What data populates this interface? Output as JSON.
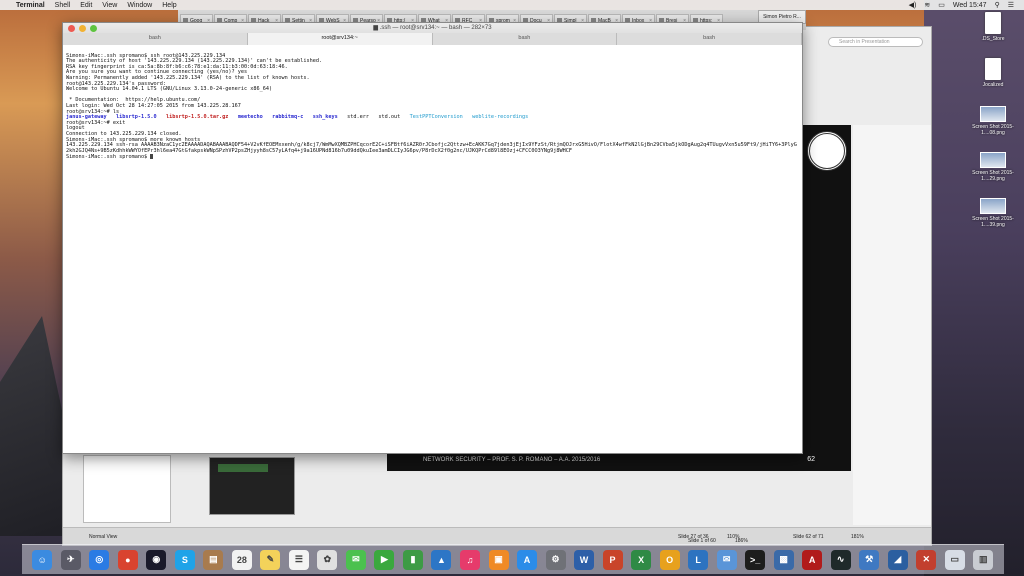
{
  "menubar": {
    "app_name": "Terminal",
    "items": [
      "Shell",
      "Edit",
      "View",
      "Window",
      "Help"
    ],
    "clock": "Wed 15:47"
  },
  "browser": {
    "tabs": [
      "Goog",
      "Comp",
      "Hack",
      "Settin",
      "WebS",
      "Pearso",
      "http:/",
      "What",
      "RFC",
      "sprom",
      "Docu",
      "Simpl",
      "MacB",
      "Inbox",
      "Bresi",
      "https:"
    ],
    "user": "Simon Pietro R..."
  },
  "presentation": {
    "search_placeholder": "Search in Presentation",
    "slide_footer": "NETWORK SECURITY – PROF. S. P. ROMANO – A.A. 2015/2016",
    "slide_number": "62",
    "status_slide": "Slide 62 of 71",
    "status_slide_left": "Slide 27 of 36",
    "status_slide_mid": "Slide 1 of 60",
    "zoom_left": "110%",
    "zoom_mid": "186%",
    "zoom_right": "181%",
    "view_label": "Normal View"
  },
  "terminal": {
    "title": "root@srv134:~ — bash — 282×73",
    "title_prefix": ".ssh",
    "tabs": [
      "bash",
      "root@srv134:~",
      "bash",
      "bash"
    ],
    "lines": [
      "Simons-iMac:.ssh spromano$ ssh root@143.225.229.134",
      "The authenticity of host '143.225.229.134 (143.225.229.134)' can't be established.",
      "RSA key fingerprint is ca:5a:8b:8f:b6:c6:78:e1:da:11:b3:00:0d:63:18:46.",
      "Are you sure you want to continue connecting (yes/no)? yes",
      "Warning: Permanently added '143.225.229.134' (RSA) to the list of known hosts.",
      "root@143.225.229.134's password:",
      "Welcome to Ubuntu 14.04.1 LTS (GNU/Linux 3.13.0-24-generic x86_64)",
      "",
      " * Documentation:  https://help.ubuntu.com/",
      "Last login: Wed Oct 28 14:27:05 2015 from 143.225.28.167",
      "root@srv134:~# ls"
    ],
    "ls_items": [
      {
        "name": "janus-gateway",
        "kind": "dir"
      },
      {
        "name": "libsrtp-1.5.0",
        "kind": "dir"
      },
      {
        "name": "libsrtp-1.5.0.tar.gz",
        "kind": "arch"
      },
      {
        "name": "meetecho",
        "kind": "dir"
      },
      {
        "name": "rabbitmq-c",
        "kind": "dir"
      },
      {
        "name": "ssh_keys",
        "kind": "dir"
      },
      {
        "name": "std.err",
        "kind": "plain"
      },
      {
        "name": "std.out",
        "kind": "plain"
      },
      {
        "name": "TestPPTConversion",
        "kind": "hl"
      },
      {
        "name": "weblite-recordings",
        "kind": "hl"
      }
    ],
    "lines_after": [
      "root@srv134:~# exit",
      "logout",
      "Connection to 143.225.229.134 closed.",
      "Simons-iMac:.ssh spromano$ more known_hosts"
    ],
    "known_host_key": "143.225.229.134 ssh-rsa AAAAB3NzaC1yc2EAAAADAQABAAABAQDF54+V2vKfEOEMxxenh/g/k8cj7/WmMwXQMBZPHCqcorE2C+iSFBtf6iAZR0rJCbofjc2Qttzw+EcAKK7Gq7jden3jEjIx9YFzSt/RtjmQOJrxG5HivO/FlotX4wfFkN2lGjBn29CVba5jkODgAug2q4TUugvVxn5u59Ft9/jHiTY6+3PlyG2kh2GJQ4Ns+9B5zKdhhkWWYOfEPr3hl6ea47GtGfakpskWNpSPzhVP2psZHjyyh8sC57yLAfq4+j9a16UPNd816b7u09ddQkuIee3amDLCIyJG6pv/P8rDcX2f0g2nc/UJKQPrCd89l8EOzj+CFCC0O3YNg9j8WHCF",
    "prompt_last": "Simons-iMac:.ssh spromano$ "
  },
  "desktop": {
    "icons": [
      {
        "label": ".DS_Store",
        "kind": "file"
      },
      {
        "label": "Jocalized",
        "kind": "file"
      },
      {
        "label": "Screen Shot 2015-1....08.png",
        "kind": "shot"
      },
      {
        "label": "Screen Shot 2015-1....29.png",
        "kind": "shot"
      },
      {
        "label": "Screen Shot 2015-1....39.png",
        "kind": "shot"
      }
    ]
  },
  "dock": {
    "icons": [
      {
        "name": "finder-icon",
        "color": "#3b8be0",
        "glyph": "☺"
      },
      {
        "name": "launchpad-icon",
        "color": "#5a5a66",
        "glyph": "✈"
      },
      {
        "name": "safari-icon",
        "color": "#2a7be4",
        "glyph": "◎"
      },
      {
        "name": "chrome-icon",
        "color": "#d9432f",
        "glyph": "●"
      },
      {
        "name": "vinyl-icon",
        "color": "#1a1a2a",
        "glyph": "◉"
      },
      {
        "name": "skype-icon",
        "color": "#1fa3e8",
        "glyph": "S"
      },
      {
        "name": "contacts-icon",
        "color": "#a87b4e",
        "glyph": "▤"
      },
      {
        "name": "calendar-icon",
        "color": "#f2f2f2",
        "glyph": "28"
      },
      {
        "name": "notes-icon",
        "color": "#f3d25a",
        "glyph": "✎"
      },
      {
        "name": "reminders-icon",
        "color": "#f4f4f4",
        "glyph": "☰"
      },
      {
        "name": "photos-icon",
        "color": "#e0e0e0",
        "glyph": "✿"
      },
      {
        "name": "messages-icon",
        "color": "#4bc14e",
        "glyph": "✉"
      },
      {
        "name": "facetime-icon",
        "color": "#3aa83e",
        "glyph": "▶"
      },
      {
        "name": "numbers-icon",
        "color": "#3d9b45",
        "glyph": "▮"
      },
      {
        "name": "keynote-icon",
        "color": "#2d76c6",
        "glyph": "▲"
      },
      {
        "name": "itunes-icon",
        "color": "#e63b6b",
        "glyph": "♫"
      },
      {
        "name": "ibooks-icon",
        "color": "#ef8a25",
        "glyph": "▣"
      },
      {
        "name": "appstore-icon",
        "color": "#2b8ce8",
        "glyph": "A"
      },
      {
        "name": "system-prefs-icon",
        "color": "#6f7177",
        "glyph": "⚙"
      },
      {
        "name": "word-icon",
        "color": "#2d5fa8",
        "glyph": "W"
      },
      {
        "name": "powerpoint-icon",
        "color": "#c9442a",
        "glyph": "P"
      },
      {
        "name": "excel-icon",
        "color": "#2f8a45",
        "glyph": "X"
      },
      {
        "name": "outlook-icon",
        "color": "#e7a11d",
        "glyph": "O"
      },
      {
        "name": "lync-icon",
        "color": "#2d73c0",
        "glyph": "L"
      },
      {
        "name": "mail-icon",
        "color": "#5a95d8",
        "glyph": "✉"
      },
      {
        "name": "terminal-icon",
        "color": "#1d1d1d",
        "glyph": ">_"
      },
      {
        "name": "virtualbox-icon",
        "color": "#3a6aa8",
        "glyph": "▩"
      },
      {
        "name": "acrobat-icon",
        "color": "#b11b1b",
        "glyph": "A"
      },
      {
        "name": "activity-monitor-icon",
        "color": "#1f2a2a",
        "glyph": "∿"
      },
      {
        "name": "xcode-icon",
        "color": "#3f79c2",
        "glyph": "⚒"
      },
      {
        "name": "wireshark-icon",
        "color": "#2b5fa0",
        "glyph": "◢"
      },
      {
        "name": "crossover-icon",
        "color": "#c23f2e",
        "glyph": "✕"
      },
      {
        "name": "documents-folder-icon",
        "color": "#d8dde6",
        "glyph": "▭"
      },
      {
        "name": "trash-icon",
        "color": "#c9ccd2",
        "glyph": "▥"
      }
    ]
  }
}
